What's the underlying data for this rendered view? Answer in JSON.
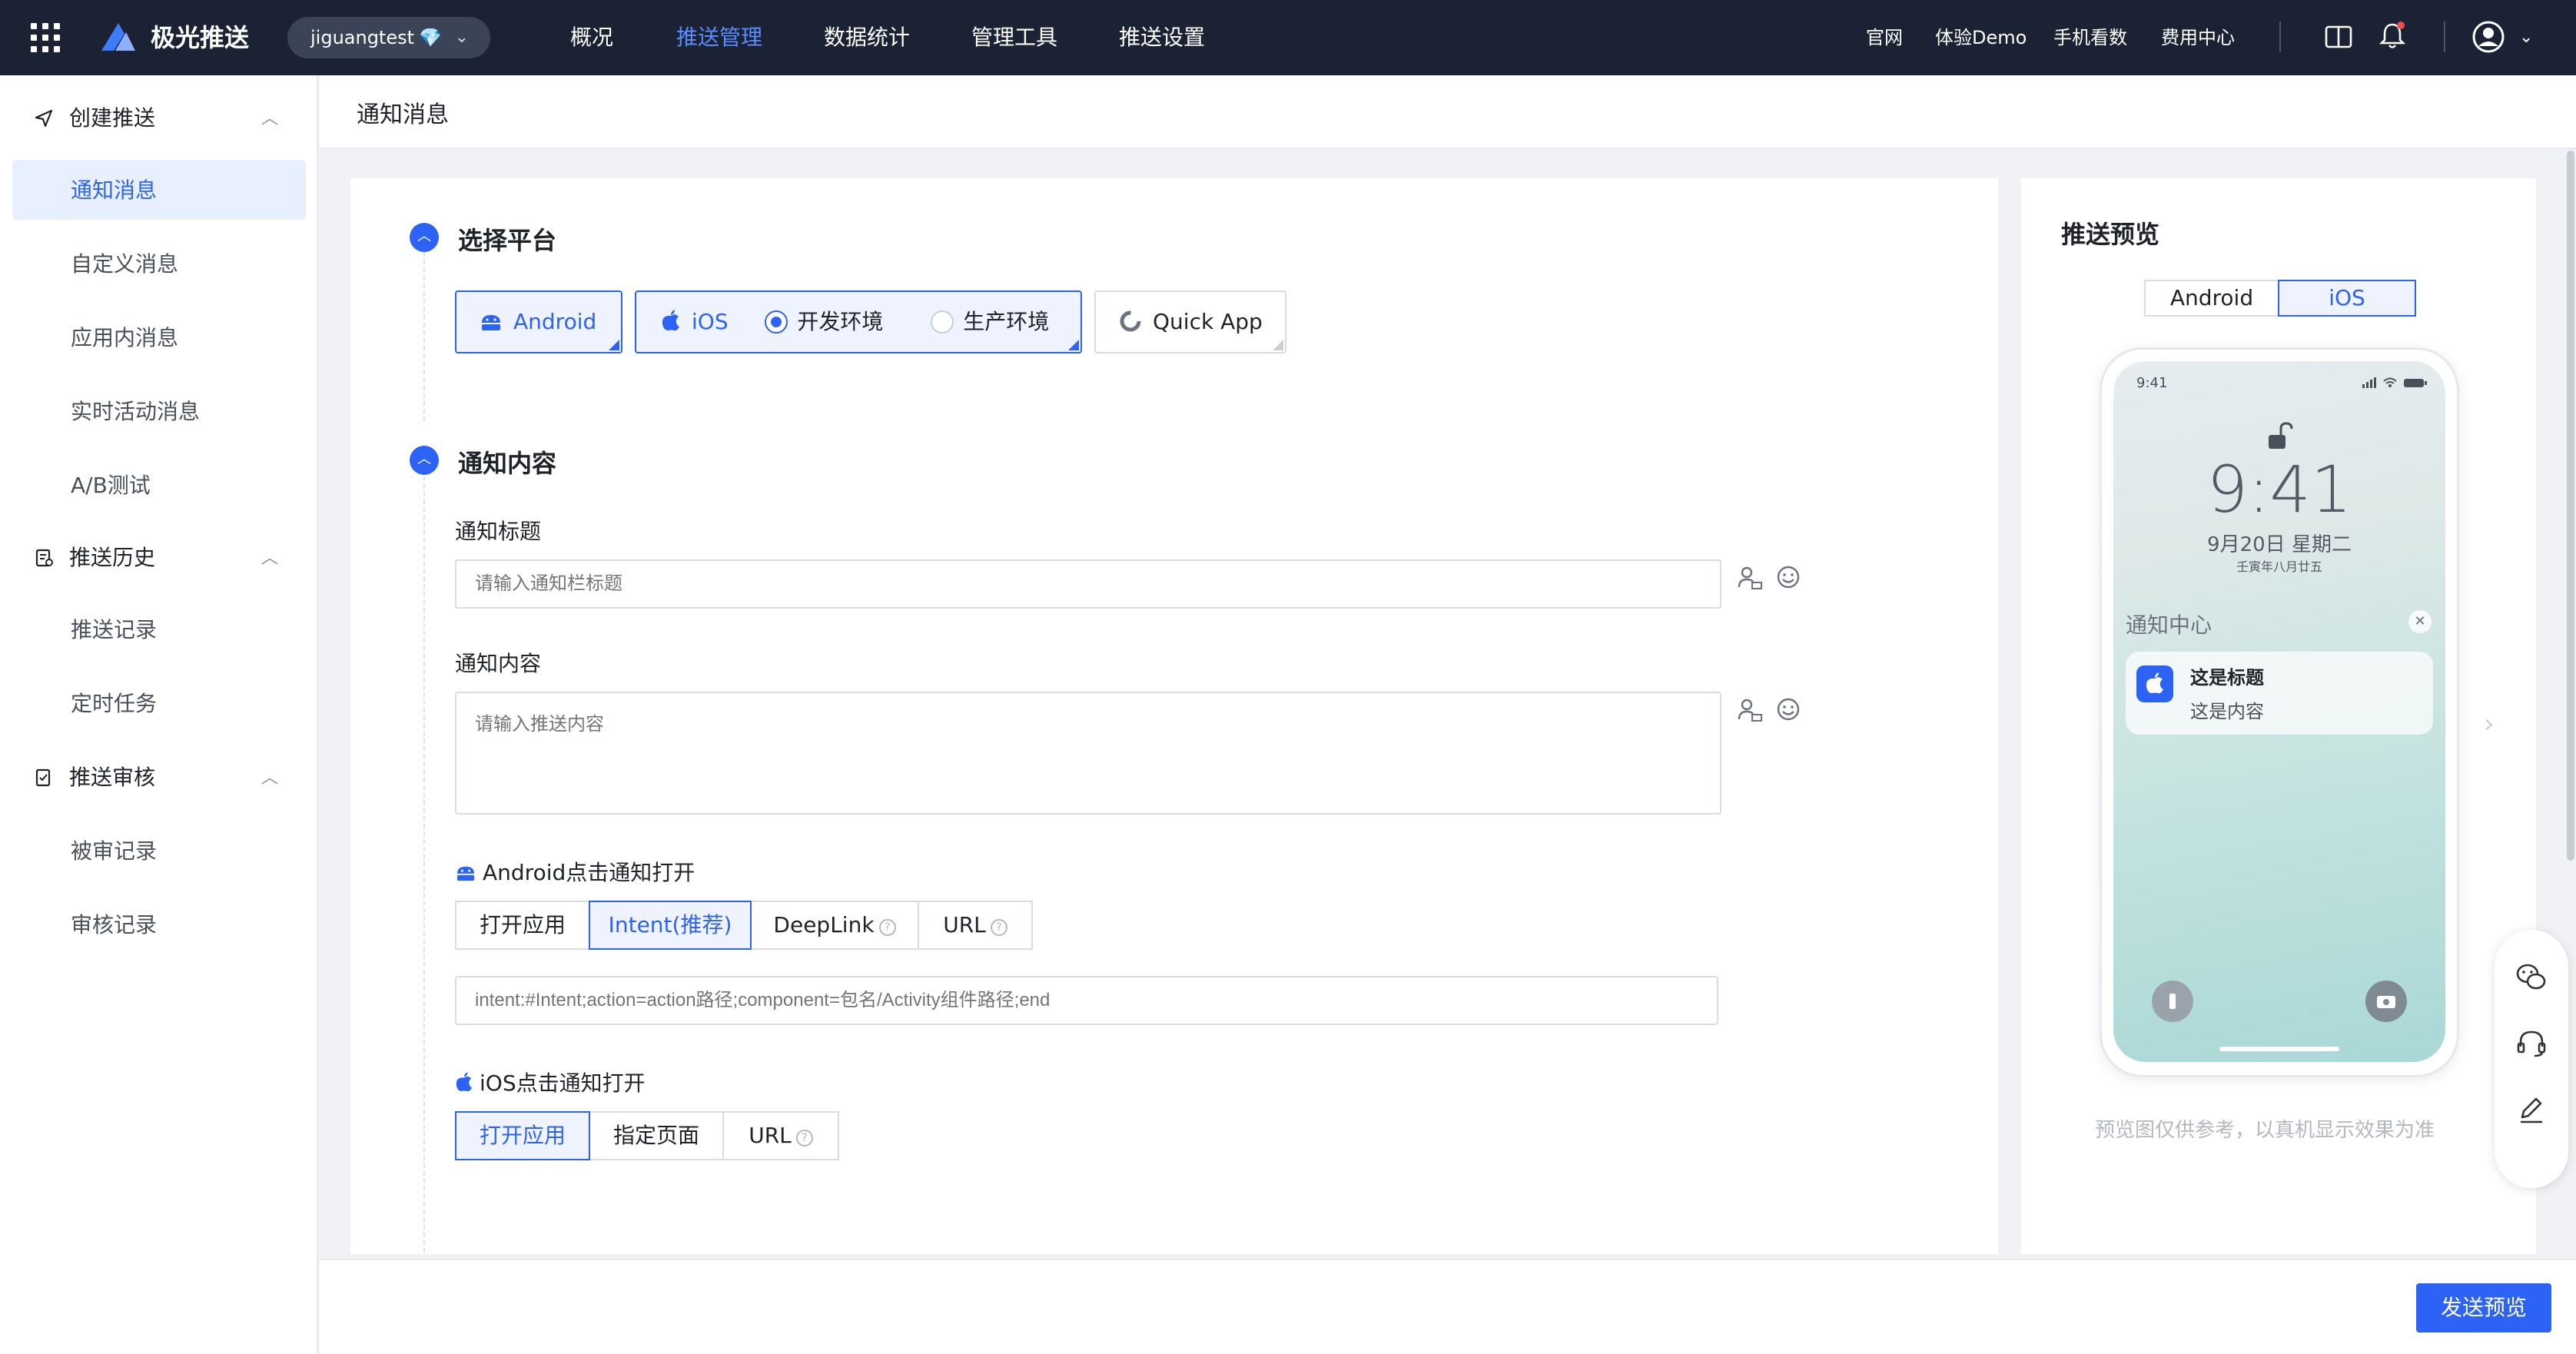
{
  "topbar": {
    "brand_name": "极光推送",
    "account": "jiguangtest",
    "account_badge": "💎",
    "nav": [
      "概况",
      "推送管理",
      "数据统计",
      "管理工具",
      "推送设置"
    ],
    "active_nav": "推送管理",
    "links": [
      "官网",
      "体验Demo",
      "手机看数",
      "费用中心"
    ],
    "icons": [
      "app-grid-icon",
      "brand-logo",
      "book-icon",
      "bell-icon",
      "user-avatar-icon"
    ],
    "colors": {
      "bar": "#1a2233",
      "accent": "#5b8cff",
      "notify_dot": "#f04d4d"
    }
  },
  "sidebar": {
    "groups": [
      {
        "label": "创建推送",
        "items": [
          "通知消息",
          "自定义消息",
          "应用内消息",
          "实时活动消息",
          "A/B测试"
        ]
      },
      {
        "label": "推送历史",
        "items": [
          "推送记录",
          "定时任务"
        ]
      },
      {
        "label": "推送审核",
        "items": [
          "被审记录",
          "审核记录"
        ]
      }
    ],
    "active_item": "通知消息"
  },
  "page": {
    "title": "通知消息"
  },
  "platform": {
    "section_title": "选择平台",
    "android": "Android",
    "ios": "iOS",
    "env_dev": "开发环境",
    "env_prod": "生产环境",
    "env_selected": "开发环境",
    "quick_app": "Quick App"
  },
  "content": {
    "section_title": "通知内容",
    "title_label": "通知标题",
    "title_placeholder": "请输入通知栏标题",
    "body_label": "通知内容",
    "body_placeholder": "请输入推送内容",
    "android_open_label": "Android点击通知打开",
    "android_options": [
      "打开应用",
      "Intent(推荐)",
      "DeepLink",
      "URL"
    ],
    "android_selected": "Intent(推荐)",
    "intent_placeholder": "intent:#Intent;action=action路径;component=包名/Activity组件路径;end",
    "ios_open_label": "iOS点击通知打开",
    "ios_options": [
      "打开应用",
      "指定页面",
      "URL"
    ],
    "ios_selected": "打开应用"
  },
  "preview": {
    "title": "推送预览",
    "tabs": [
      "Android",
      "iOS"
    ],
    "active_tab": "iOS",
    "status_time": "9:41",
    "clock": "9:41",
    "date": "9月20日 星期二",
    "lunar": "壬寅年八月廿五",
    "notif_center": "通知中心",
    "notif_title": "这是标题",
    "notif_body": "这是内容",
    "note": "预览图仅供参考，以真机显示效果为准"
  },
  "footer": {
    "send_preview": "发送预览"
  }
}
